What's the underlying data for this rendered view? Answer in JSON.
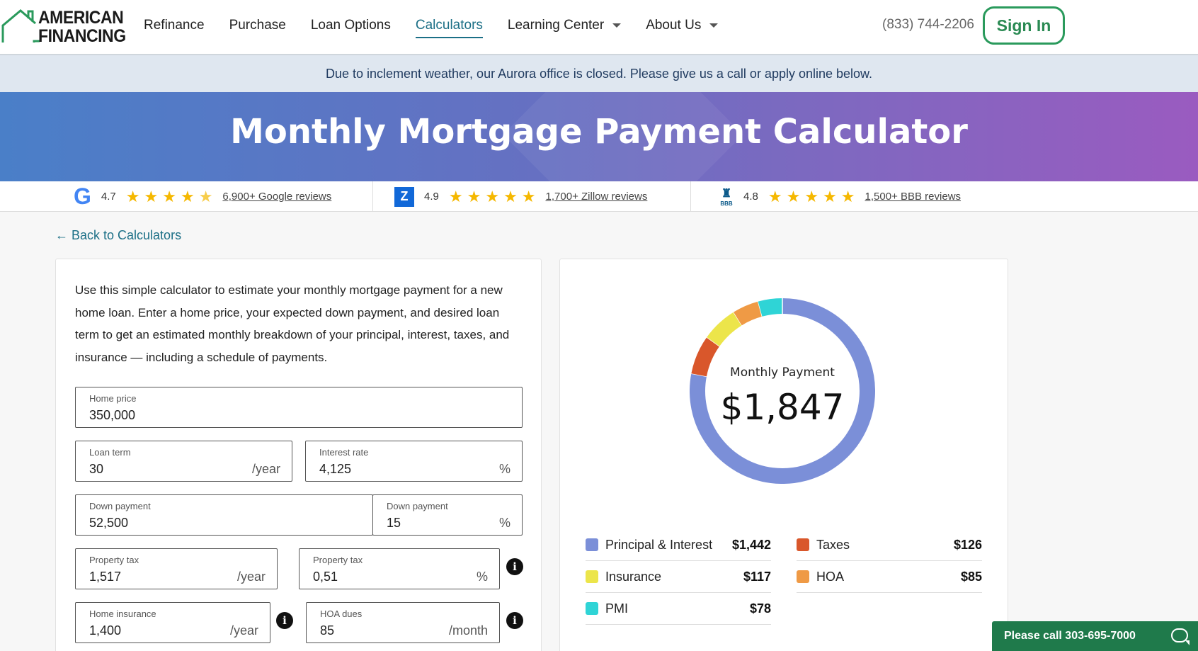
{
  "brand": {
    "logo_line1": "AMERICAN",
    "logo_line2": "FINANCING"
  },
  "nav": {
    "items": [
      {
        "label": "Refinance"
      },
      {
        "label": "Purchase"
      },
      {
        "label": "Loan Options"
      },
      {
        "label": "Calculators",
        "active": true
      },
      {
        "label": "Learning Center",
        "dropdown": true
      },
      {
        "label": "About Us",
        "dropdown": true
      }
    ],
    "phone": "(833) 744-2206",
    "signin": "Sign In"
  },
  "alert": "Due to inclement weather, our Aurora office is closed. Please give us a call or apply online below.",
  "hero": {
    "title": "Monthly Mortgage Payment Calculator"
  },
  "reviews": [
    {
      "icon": "google-icon",
      "rating": "4.7",
      "stars": 4.5,
      "link": "6,900+ Google reviews"
    },
    {
      "icon": "zillow-icon",
      "rating": "4.9",
      "stars": 5,
      "link": "1,700+ Zillow reviews"
    },
    {
      "icon": "bbb-icon",
      "rating": "4.8",
      "stars": 5,
      "link": "1,500+ BBB reviews"
    }
  ],
  "back_link": "← Back to Calculators",
  "intro": "Use this simple calculator to estimate your monthly mortgage payment for a new home loan. Enter a home price, your expected down payment, and desired loan term to get an estimated monthly breakdown of your principal, interest, taxes, and insurance — including a schedule of payments.",
  "form": {
    "home_price": {
      "label": "Home price",
      "value": "350,000"
    },
    "loan_term": {
      "label": "Loan term",
      "value": "30",
      "unit": "/year"
    },
    "interest_rate": {
      "label": "Interest rate",
      "value": "4,125",
      "unit": "%"
    },
    "down_payment_amount": {
      "label": "Down payment",
      "value": "52,500"
    },
    "down_payment_percent": {
      "label": "Down payment",
      "value": "15",
      "unit": "%"
    },
    "property_tax_amount": {
      "label": "Property tax",
      "value": "1,517",
      "unit": "/year"
    },
    "property_tax_percent": {
      "label": "Property tax",
      "value": "0,51",
      "unit": "%"
    },
    "home_insurance": {
      "label": "Home insurance",
      "value": "1,400",
      "unit": "/year"
    },
    "hoa_dues": {
      "label": "HOA dues",
      "value": "85",
      "unit": "/month"
    }
  },
  "summary": {
    "center_label": "Monthly Payment",
    "center_value": "$1,847",
    "breakdown": [
      {
        "label": "Principal & Interest",
        "value": "$1,442",
        "amount": 1442,
        "color": "#7b8fd8"
      },
      {
        "label": "Taxes",
        "value": "$126",
        "amount": 126,
        "color": "#d9572b"
      },
      {
        "label": "Insurance",
        "value": "$117",
        "amount": 117,
        "color": "#ece54a"
      },
      {
        "label": "HOA",
        "value": "$85",
        "amount": 85,
        "color": "#ef9a45"
      },
      {
        "label": "PMI",
        "value": "$78",
        "amount": 78,
        "color": "#2fd4d6"
      }
    ]
  },
  "chat": {
    "label": "Please call 303-695-7000"
  },
  "colors": {
    "accent": "#1b6f86",
    "brand_green": "#2a9a5c",
    "chat_green": "#1f7a4b"
  }
}
